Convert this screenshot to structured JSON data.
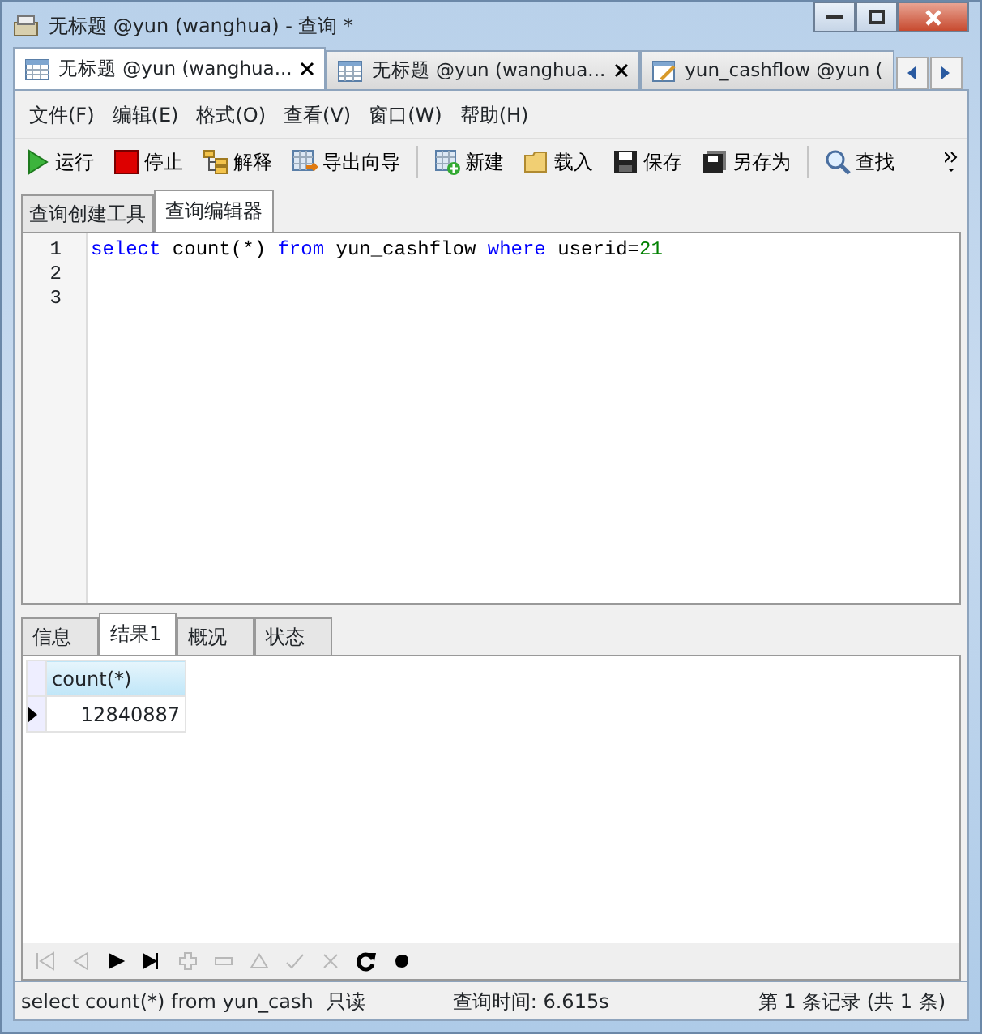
{
  "window": {
    "title": "无标题 @yun (wanghua) - 查询 *"
  },
  "doc_tabs": [
    {
      "label": "无标题 @yun (wanghua...",
      "selected": true,
      "closable": true,
      "kind": "query"
    },
    {
      "label": "无标题 @yun (wanghua...",
      "selected": false,
      "closable": true,
      "kind": "query"
    },
    {
      "label": "yun_cashflow @yun (",
      "selected": false,
      "closable": false,
      "kind": "table"
    }
  ],
  "menu": [
    "文件(F)",
    "编辑(E)",
    "格式(O)",
    "查看(V)",
    "窗口(W)",
    "帮助(H)"
  ],
  "toolbar": [
    {
      "kind": "run",
      "label": "运行"
    },
    {
      "kind": "stop",
      "label": "停止"
    },
    {
      "kind": "explain",
      "label": "解释"
    },
    {
      "kind": "export",
      "label": "导出向导"
    },
    {
      "kind": "sep"
    },
    {
      "kind": "new",
      "label": "新建"
    },
    {
      "kind": "load",
      "label": "载入"
    },
    {
      "kind": "save",
      "label": "保存"
    },
    {
      "kind": "saveas",
      "label": "另存为"
    },
    {
      "kind": "sep"
    },
    {
      "kind": "find",
      "label": "查找"
    }
  ],
  "sub_tabs": [
    {
      "label": "查询创建工具",
      "selected": false
    },
    {
      "label": "查询编辑器",
      "selected": true
    }
  ],
  "editor": {
    "lines": [
      {
        "number": "1",
        "tokens": [
          {
            "kind": "keyword",
            "text": "select"
          },
          {
            "kind": "plain",
            "text": " count(*) "
          },
          {
            "kind": "keyword",
            "text": "from"
          },
          {
            "kind": "plain",
            "text": " yun_cashflow "
          },
          {
            "kind": "keyword",
            "text": "where"
          },
          {
            "kind": "plain",
            "text": " userid="
          },
          {
            "kind": "number",
            "text": "21"
          }
        ]
      },
      {
        "number": "2"
      },
      {
        "number": "3"
      }
    ]
  },
  "result_tabs": [
    {
      "label": "信息",
      "selected": false
    },
    {
      "label": "结果1",
      "selected": true
    },
    {
      "label": "概况",
      "selected": false
    },
    {
      "label": "状态",
      "selected": false
    }
  ],
  "grid": {
    "columns": [
      "count(*)"
    ],
    "rows": [
      {
        "current": true,
        "cells": [
          "12840887"
        ]
      }
    ]
  },
  "nav": [
    {
      "kind": "first",
      "disabled": true
    },
    {
      "kind": "prev",
      "disabled": true
    },
    {
      "kind": "next",
      "disabled": false
    },
    {
      "kind": "last",
      "disabled": false
    },
    {
      "kind": "add",
      "disabled": true
    },
    {
      "kind": "delete",
      "disabled": true
    },
    {
      "kind": "up",
      "disabled": true
    },
    {
      "kind": "apply",
      "disabled": true
    },
    {
      "kind": "cancel",
      "disabled": true
    },
    {
      "kind": "refresh",
      "disabled": false
    },
    {
      "kind": "stop",
      "disabled": false
    }
  ],
  "status_bar": {
    "query": "select count(*) from yun_cash",
    "mode": "只读",
    "time": "查询时间: 6.615s",
    "records": "第 1 条记录 (共 1 条)"
  }
}
